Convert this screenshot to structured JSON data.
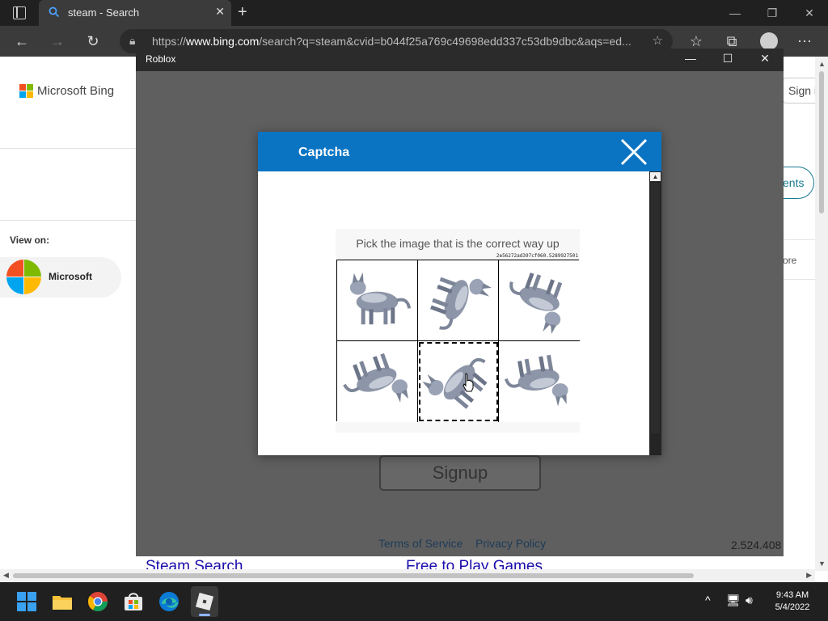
{
  "browser": {
    "tab_title": "steam - Search",
    "new_tab_symbol": "+",
    "url_prefix": "https://",
    "url_host": "www.bing.com",
    "url_rest": "/search?q=steam&cvid=b044f25a769c49698edd337c53db9dbc&aqs=ed..."
  },
  "bing": {
    "logo_text": "Microsoft Bing",
    "sign_in": "Sign i",
    "view_on_label": "View on:",
    "view_on_item": "Microsoft",
    "right_pill_text": "ents",
    "right_more_text": "ore",
    "bottom_links": [
      "Steam Search",
      "Free to Play Games"
    ]
  },
  "roblox": {
    "window_title": "Roblox",
    "signup_label": "Signup",
    "terms_label": "Terms of Service",
    "privacy_label": "Privacy Policy",
    "version": "2.524.408"
  },
  "captcha": {
    "title": "Captcha",
    "prompt": "Pick the image that is the correct way up",
    "challenge_id": "2e56272ad397cf060.5289927501",
    "tiles": [
      {
        "name": "tile-1",
        "rotation": 0,
        "selected": false
      },
      {
        "name": "tile-2",
        "rotation": 110,
        "selected": false
      },
      {
        "name": "tile-3",
        "rotation": 200,
        "selected": false
      },
      {
        "name": "tile-4",
        "rotation": 160,
        "selected": false
      },
      {
        "name": "tile-5",
        "rotation": 310,
        "selected": true
      },
      {
        "name": "tile-6",
        "rotation": 170,
        "selected": false
      }
    ]
  },
  "taskbar": {
    "time": "9:43 AM",
    "date": "5/4/2022",
    "apps": [
      "start-icon",
      "file-explorer-icon",
      "chrome-icon",
      "store-icon",
      "edge-icon",
      "roblox-icon"
    ]
  },
  "colors": {
    "captcha_header": "#0a74c3",
    "roblox_backdrop": "#5f5f5f",
    "bing_link": "#1a0dab"
  }
}
